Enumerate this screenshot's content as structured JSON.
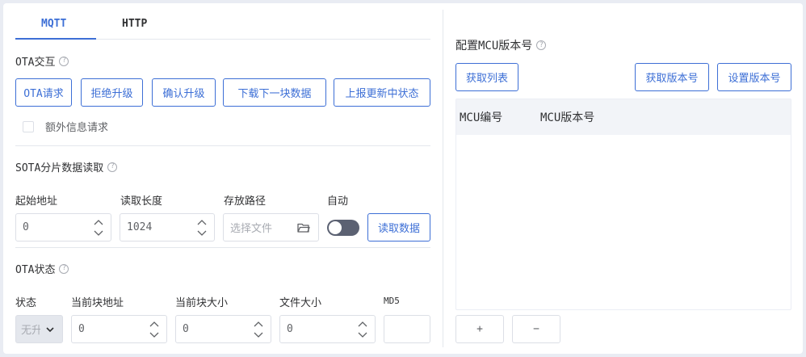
{
  "tabs": [
    {
      "label": "MQTT",
      "active": true
    },
    {
      "label": "HTTP",
      "active": false
    }
  ],
  "ota_interaction": {
    "title": "OTA交互",
    "buttons": [
      "OTA请求",
      "拒绝升级",
      "确认升级",
      "下载下一块数据",
      "上报更新中状态"
    ],
    "extra_info_checkbox": "额外信息请求"
  },
  "sota": {
    "title": "SOTA分片数据读取",
    "start_address_label": "起始地址",
    "start_address_value": "0",
    "read_length_label": "读取长度",
    "read_length_value": "1024",
    "storage_path_label": "存放路径",
    "storage_path_placeholder": "选择文件",
    "auto_label": "自动",
    "read_button": "读取数据"
  },
  "ota_status": {
    "title": "OTA状态",
    "status_label": "状态",
    "status_value": "无升",
    "current_block_address_label": "当前块地址",
    "current_block_address_value": "0",
    "current_block_size_label": "当前块大小",
    "current_block_size_value": "0",
    "file_size_label": "文件大小",
    "file_size_value": "0",
    "md5_label": "MD5",
    "md5_value": ""
  },
  "mcu_config": {
    "title": "配置MCU版本号",
    "get_list_button": "获取列表",
    "get_version_button": "获取版本号",
    "set_version_button": "设置版本号",
    "columns": [
      "MCU编号",
      "MCU版本号"
    ],
    "add_button": "+",
    "remove_button": "−"
  },
  "colors": {
    "accent": "#3d6fd6",
    "border": "#dcdfe6",
    "switch_off": "#5b6172"
  }
}
